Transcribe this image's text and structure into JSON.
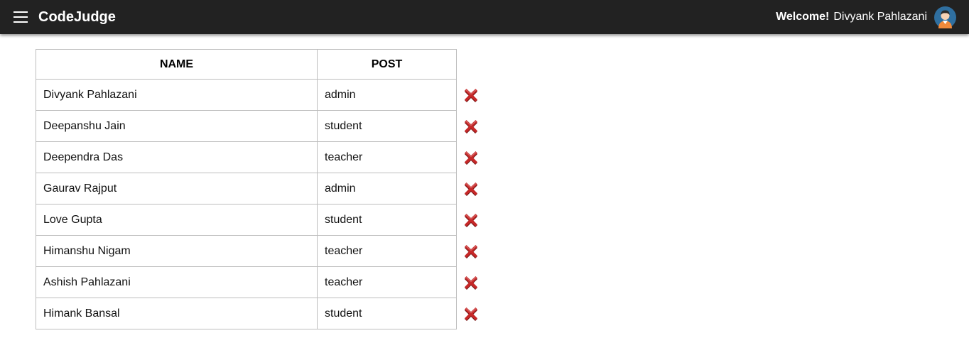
{
  "header": {
    "brand": "CodeJudge",
    "welcome_label": "Welcome!",
    "user_name": "Divyank Pahlazani",
    "menu_icon": "hamburger-menu-icon",
    "avatar_icon": "user-avatar-icon"
  },
  "table": {
    "headers": {
      "name": "NAME",
      "post": "POST"
    },
    "delete_icon": "close-icon",
    "delete_color": "#c62828",
    "rows": [
      {
        "name": "Divyank Pahlazani",
        "post": "admin"
      },
      {
        "name": "Deepanshu Jain",
        "post": "student"
      },
      {
        "name": "Deependra Das",
        "post": "teacher"
      },
      {
        "name": "Gaurav Rajput",
        "post": "admin"
      },
      {
        "name": "Love Gupta",
        "post": "student"
      },
      {
        "name": "Himanshu Nigam",
        "post": "teacher"
      },
      {
        "name": "Ashish Pahlazani",
        "post": "teacher"
      },
      {
        "name": "Himank Bansal",
        "post": "student"
      }
    ]
  },
  "colors": {
    "navbar_bg": "#222222",
    "avatar_bg": "#2f6fa0"
  }
}
